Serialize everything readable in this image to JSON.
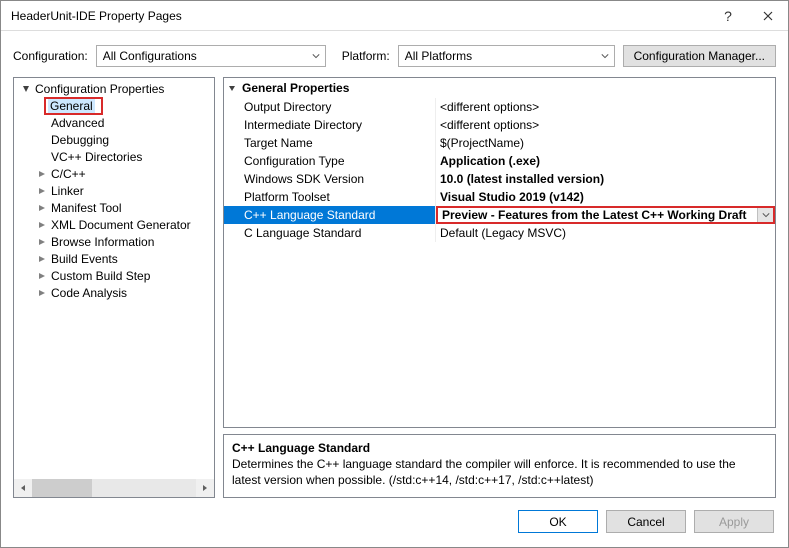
{
  "window": {
    "title": "HeaderUnit-IDE Property Pages"
  },
  "toolbar": {
    "config_label": "Configuration:",
    "config_value": "All Configurations",
    "platform_label": "Platform:",
    "platform_value": "All Platforms",
    "manager_label": "Configuration Manager..."
  },
  "tree": {
    "root": "Configuration Properties",
    "general": "General",
    "items": [
      "Advanced",
      "Debugging",
      "VC++ Directories",
      "C/C++",
      "Linker",
      "Manifest Tool",
      "XML Document Generator",
      "Browse Information",
      "Build Events",
      "Custom Build Step",
      "Code Analysis"
    ],
    "expandable": [
      false,
      false,
      false,
      true,
      true,
      true,
      true,
      true,
      true,
      true,
      true
    ]
  },
  "grid": {
    "header": "General Properties",
    "rows": [
      {
        "name": "Output Directory",
        "value": "<different options>",
        "bold": false
      },
      {
        "name": "Intermediate Directory",
        "value": "<different options>",
        "bold": false
      },
      {
        "name": "Target Name",
        "value": "$(ProjectName)",
        "bold": false
      },
      {
        "name": "Configuration Type",
        "value": "Application (.exe)",
        "bold": true
      },
      {
        "name": "Windows SDK Version",
        "value": "10.0 (latest installed version)",
        "bold": true
      },
      {
        "name": "Platform Toolset",
        "value": "Visual Studio 2019 (v142)",
        "bold": true
      },
      {
        "name": "C++ Language Standard",
        "value": "Preview - Features from the Latest C++ Working Draft",
        "bold": true,
        "selected": true
      },
      {
        "name": "C Language Standard",
        "value": "Default (Legacy MSVC)",
        "bold": false
      }
    ]
  },
  "description": {
    "title": "C++ Language Standard",
    "text": "Determines the C++ language standard the compiler will enforce. It is recommended to use the latest version when possible.  (/std:c++14, /std:c++17, /std:c++latest)"
  },
  "footer": {
    "ok": "OK",
    "cancel": "Cancel",
    "apply": "Apply"
  }
}
